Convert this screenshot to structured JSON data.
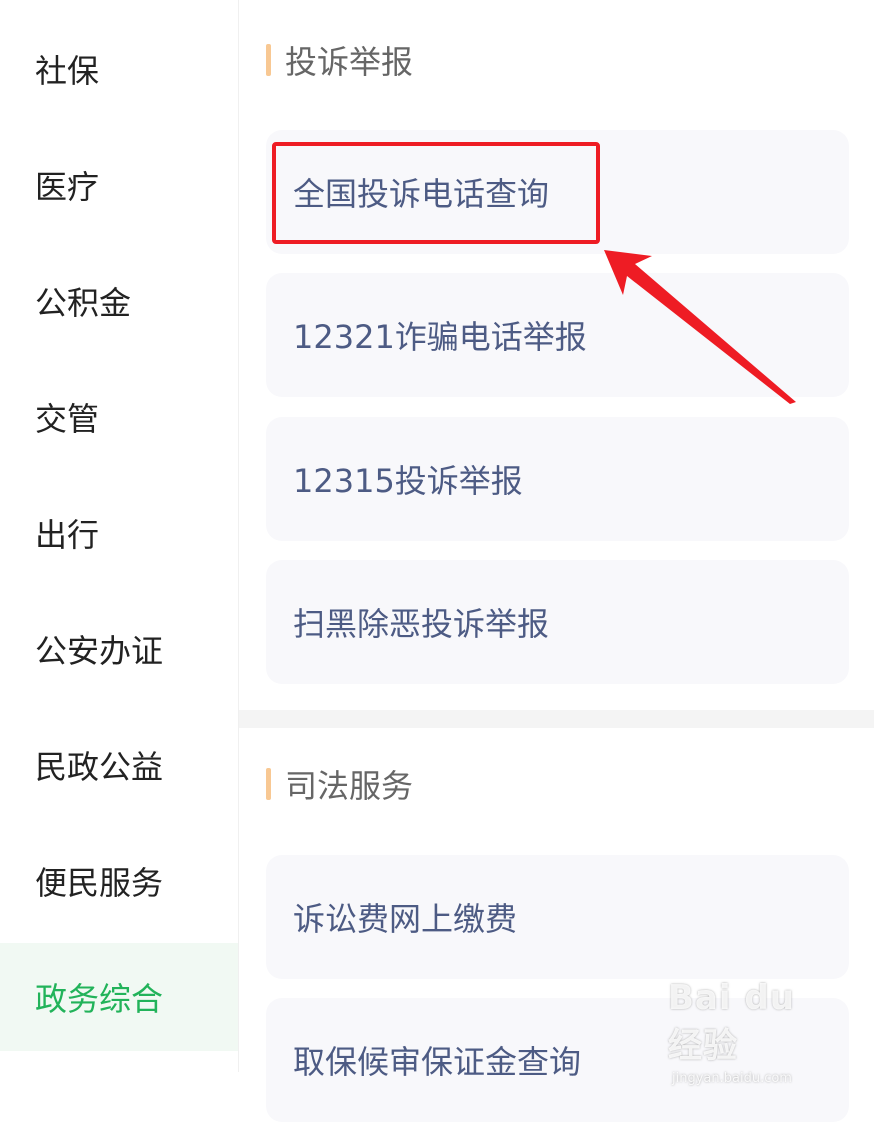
{
  "sidebar": {
    "items": [
      {
        "label": "社保"
      },
      {
        "label": "医疗"
      },
      {
        "label": "公积金"
      },
      {
        "label": "交管"
      },
      {
        "label": "出行"
      },
      {
        "label": "公安办证"
      },
      {
        "label": "民政公益"
      },
      {
        "label": "便民服务"
      },
      {
        "label": "政务综合"
      }
    ],
    "active_label": "政务综合"
  },
  "sections": [
    {
      "title": "投诉举报",
      "items": [
        {
          "label": "全国投诉电话查询"
        },
        {
          "label": "12321诈骗电话举报"
        },
        {
          "label": "12315投诉举报"
        },
        {
          "label": "扫黑除恶投诉举报"
        }
      ]
    },
    {
      "title": "司法服务",
      "items": [
        {
          "label": "诉讼费网上缴费"
        },
        {
          "label": "取保候审保证金查询"
        }
      ]
    }
  ],
  "annotation": {
    "color": "#ee1c24"
  },
  "watermark": {
    "main": "Bai du 经验",
    "sub": "jingyan.baidu.com"
  },
  "colors": {
    "accent": "#22b35a",
    "section_bar": "#f8c893",
    "link": "#4d5b84"
  }
}
